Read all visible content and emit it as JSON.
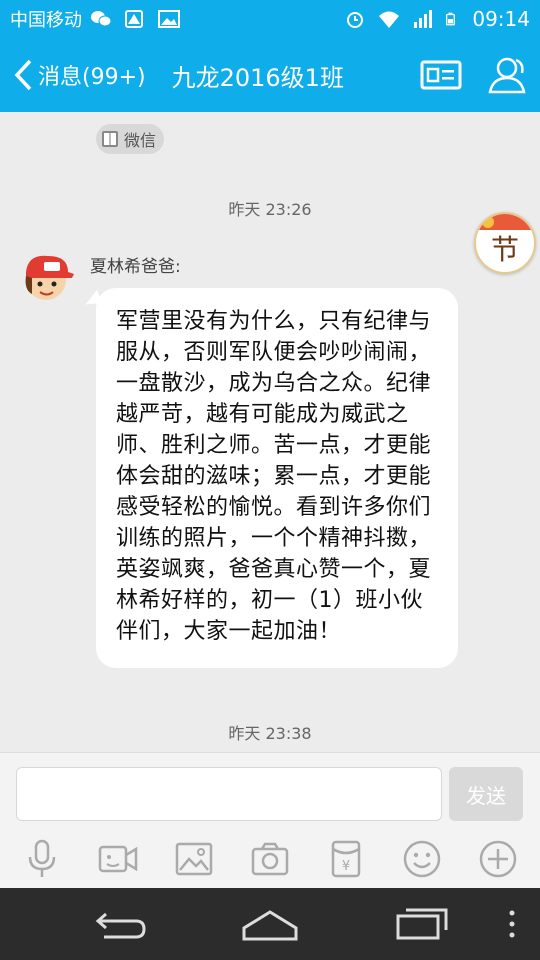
{
  "status_bar": {
    "carrier": "中国移动",
    "time": "09:14"
  },
  "header": {
    "back_label": "消息(99+)",
    "title": "九龙2016级1班"
  },
  "chat": {
    "source_chip": "微信",
    "timestamp_1": "昨天 23:26",
    "sender": "夏林希爸爸:",
    "message": "军营里没有为什么，只有纪律与服从，否则军队便会吵吵闹闹，一盘散沙，成为乌合之众。纪律越严苛，越有可能成为威武之师、胜利之师。苦一点，才更能体会甜的滋味；累一点，才更能感受轻松的愉悦。看到许多你们训练的照片，一个个精神抖擞，英姿飒爽，爸爸真心赞一个，夏林希好样的，初一（1）班小伙伴们，大家一起加油！",
    "timestamp_2": "昨天 23:38",
    "festival_badge": "节"
  },
  "input_bar": {
    "input_value": "",
    "send_label": "发送",
    "tools": [
      "microphone-icon",
      "video-icon",
      "image-icon",
      "camera-icon",
      "red-packet-icon",
      "emoji-icon",
      "plus-icon"
    ]
  },
  "colors": {
    "accent": "#10adeb",
    "chat_bg": "#ececec",
    "nav_bg": "#2c2c2c"
  }
}
